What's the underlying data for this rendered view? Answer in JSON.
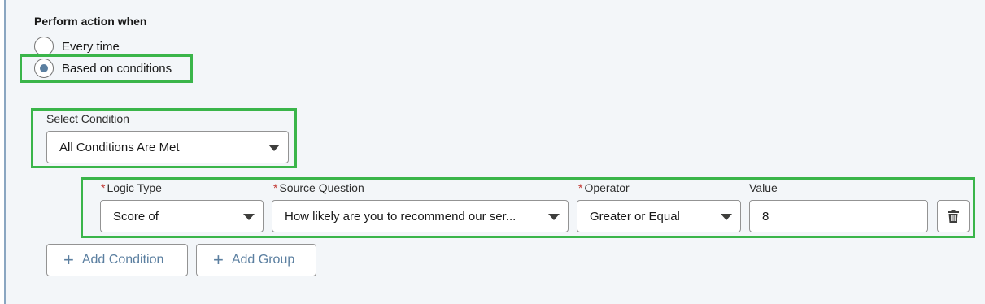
{
  "section": {
    "title": "Perform action when"
  },
  "radios": [
    {
      "label": "Every time",
      "selected": false
    },
    {
      "label": "Based on conditions",
      "selected": true
    }
  ],
  "condition": {
    "label": "Select Condition",
    "value": "All Conditions Are Met"
  },
  "rule": {
    "logic_type": {
      "label": "Logic Type",
      "required": "*",
      "value": "Score of"
    },
    "source_question": {
      "label": "Source Question",
      "required": "*",
      "value": "How likely are you to recommend our ser..."
    },
    "operator": {
      "label": "Operator",
      "required": "*",
      "value": "Greater or Equal"
    },
    "value": {
      "label": "Value",
      "value": "8"
    }
  },
  "buttons": {
    "add_condition": "Add Condition",
    "add_group": "Add Group",
    "plus": "+"
  },
  "colors": {
    "highlight": "#3ab54a",
    "accent": "#5b7fa0",
    "required": "#c23934",
    "background": "#f3f6f9"
  },
  "icons": {
    "radio_selected": "radio-selected-icon",
    "dropdown": "chevron-down-icon",
    "delete": "trash-icon",
    "add": "plus-icon"
  }
}
